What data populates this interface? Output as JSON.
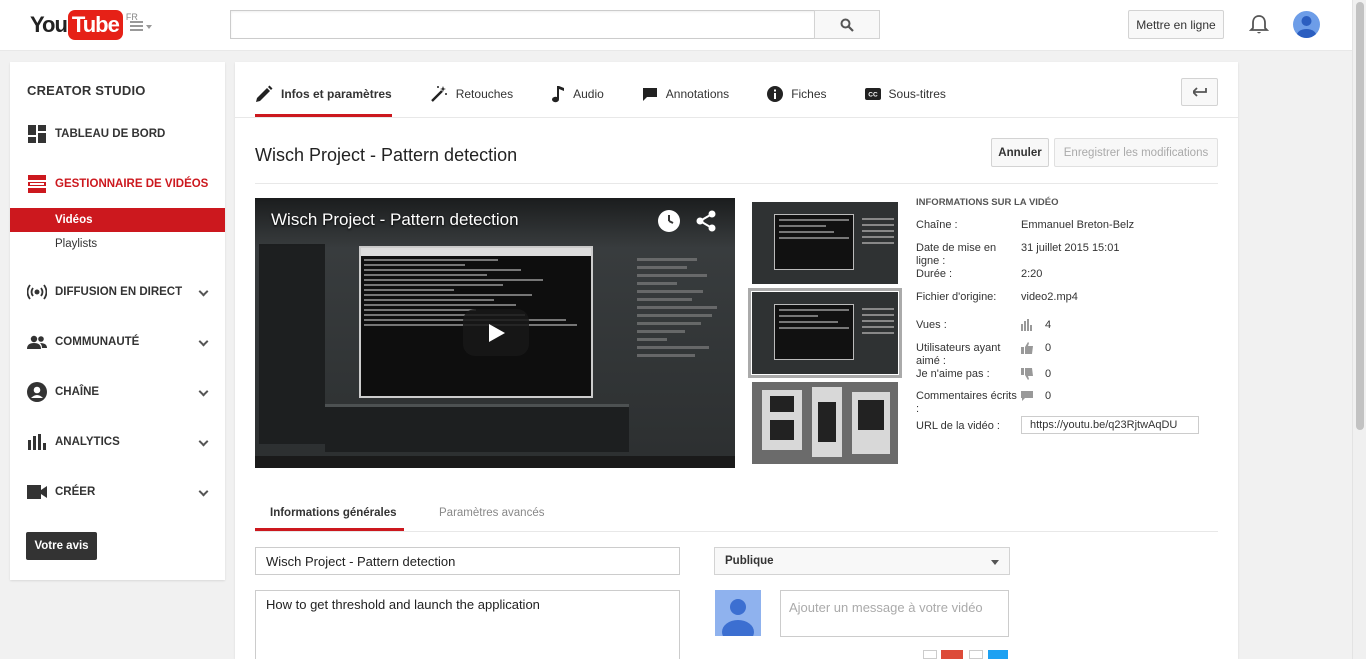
{
  "header": {
    "logo_you": "You",
    "logo_tube": "Tube",
    "logo_region": "FR",
    "upload_label": "Mettre en ligne",
    "search_placeholder": ""
  },
  "sidebar": {
    "title": "CREATOR STUDIO",
    "items": [
      {
        "label": "TABLEAU DE BORD",
        "icon": "dashboard-icon"
      },
      {
        "label": "GESTIONNAIRE DE VIDÉOS",
        "icon": "video-manager-icon",
        "active": true
      },
      {
        "label": "DIFFUSION EN DIRECT",
        "icon": "live-icon"
      },
      {
        "label": "COMMUNAUTÉ",
        "icon": "community-icon"
      },
      {
        "label": "CHAÎNE",
        "icon": "channel-icon"
      },
      {
        "label": "ANALYTICS",
        "icon": "analytics-icon"
      },
      {
        "label": "CRÉER",
        "icon": "create-icon"
      }
    ],
    "subitems": [
      {
        "label": "Vidéos",
        "active": true
      },
      {
        "label": "Playlists"
      }
    ],
    "feedback_label": "Votre avis"
  },
  "tabs": [
    {
      "label": "Infos et paramètres",
      "active": true
    },
    {
      "label": "Retouches"
    },
    {
      "label": "Audio"
    },
    {
      "label": "Annotations"
    },
    {
      "label": "Fiches"
    },
    {
      "label": "Sous-titres"
    }
  ],
  "video": {
    "title": "Wisch Project - Pattern detection",
    "player_title": "Wisch Project - Pattern detection",
    "cancel_label": "Annuler",
    "save_label": "Enregistrer les modifications"
  },
  "info": {
    "heading": "INFORMATIONS SUR LA VIDÉO",
    "channel_label": "Chaîne :",
    "channel_value": "Emmanuel Breton-Belz",
    "date_label": "Date de mise en ligne :",
    "date_value": "31 juillet 2015 15:01",
    "duration_label": "Durée :",
    "duration_value": "2:20",
    "file_label": "Fichier d'origine:",
    "file_value": "video2.mp4",
    "views_label": "Vues :",
    "views_value": "4",
    "likes_label": "Utilisateurs ayant aimé :",
    "likes_value": "0",
    "dislikes_label": "Je n'aime pas :",
    "dislikes_value": "0",
    "comments_label": "Commentaires écrits :",
    "comments_value": "0",
    "url_label": "URL de la vidéo :",
    "url_value": "https://youtu.be/q23RjtwAqDU"
  },
  "subtabs": [
    {
      "label": "Informations générales",
      "active": true
    },
    {
      "label": "Paramètres avancés"
    }
  ],
  "form": {
    "title_value": "Wisch Project - Pattern detection",
    "description_value": "How to get threshold and launch the application",
    "privacy_value": "Publique",
    "message_placeholder": "Ajouter un message à votre vidéo"
  }
}
